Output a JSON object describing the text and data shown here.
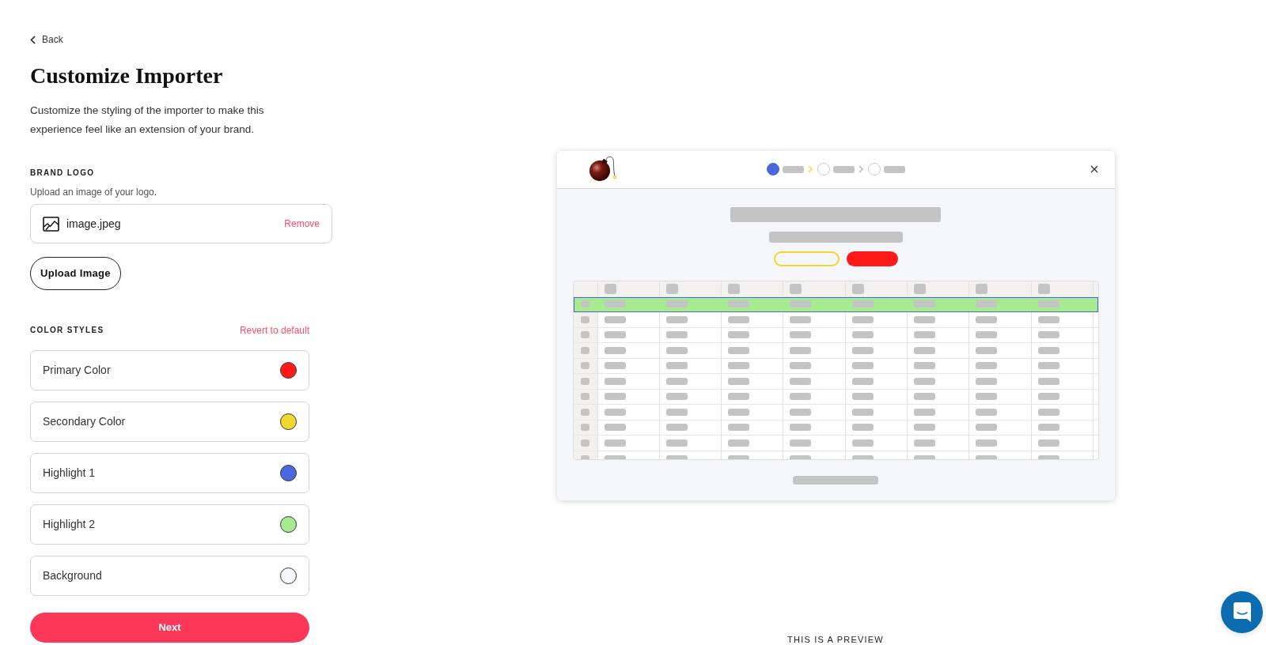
{
  "back_link": {
    "label": "Back"
  },
  "title": "Customize Importer",
  "description": "Customize the styling of the importer to make this experience feel like an extension of your brand.",
  "brand_logo": {
    "heading": "BRAND LOGO",
    "hint": "Upload an image of your logo.",
    "file_name": "image.jpeg",
    "remove_label": "Remove",
    "upload_button": "Upload Image"
  },
  "color_styles": {
    "heading": "COLOR STYLES",
    "revert_label": "Revert to default",
    "items": [
      {
        "label": "Primary Color",
        "color": "#ff1a1a"
      },
      {
        "label": "Secondary Color",
        "color": "#f2d72f"
      },
      {
        "label": "Highlight 1",
        "color": "#4967de"
      },
      {
        "label": "Highlight 2",
        "color": "#a6eb8f"
      },
      {
        "label": "Background",
        "color": "#f5f6fa"
      }
    ]
  },
  "next_button": "Next",
  "preview": {
    "steps": [
      {
        "selected": true
      },
      {
        "selected": false
      },
      {
        "selected": false
      }
    ],
    "caption": "THIS IS A PREVIEW"
  }
}
